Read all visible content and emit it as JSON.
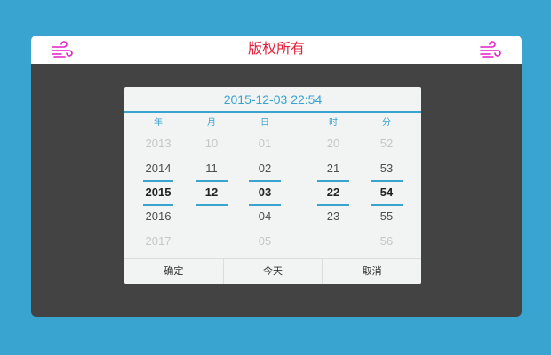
{
  "header": {
    "title": "版权所有",
    "left_icon": "wind-icon",
    "right_icon": "wind-icon",
    "icon_color": "#e020c8",
    "title_color": "#e4213b"
  },
  "picker": {
    "current": "2015-12-03 22:54",
    "accent": "#38a4cf",
    "columns": {
      "year": {
        "label": "年",
        "items": [
          "2013",
          "2014",
          "2015",
          "2016",
          "2017"
        ]
      },
      "month": {
        "label": "月",
        "items": [
          "10",
          "11",
          "12",
          "",
          ""
        ]
      },
      "day": {
        "label": "日",
        "items": [
          "01",
          "02",
          "03",
          "04",
          "05"
        ]
      },
      "hour": {
        "label": "时",
        "items": [
          "20",
          "21",
          "22",
          "23",
          ""
        ]
      },
      "minute": {
        "label": "分",
        "items": [
          "52",
          "53",
          "54",
          "55",
          "56"
        ]
      }
    },
    "buttons": {
      "confirm": "确定",
      "today": "今天",
      "cancel": "取消"
    }
  }
}
